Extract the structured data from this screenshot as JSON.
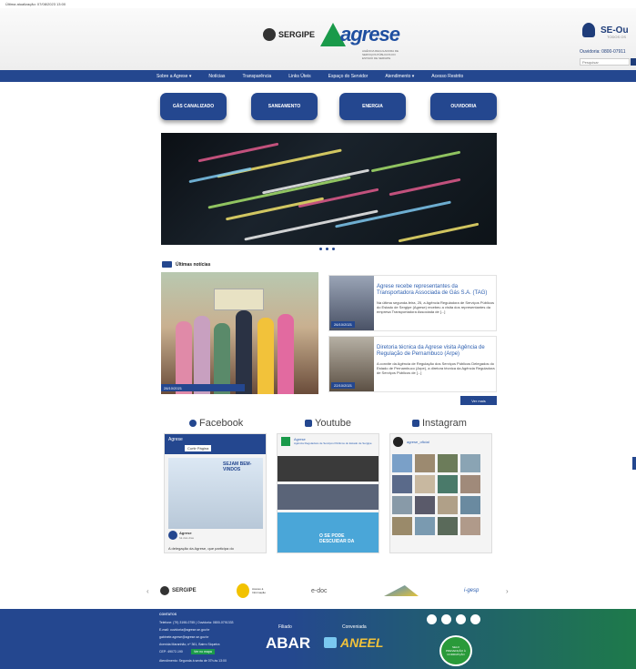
{
  "topline": "Última atualização: 07/08/2023 13:00",
  "header": {
    "sergipe_logo": "SERGIPE",
    "agrese_logo": "agrese",
    "agrese_subtitle": "AGÊNCIA REGULADORA DE SERVIÇOS PÚBLICOS DO ESTADO DE SERGIPE",
    "seou_title": "SE-Ou",
    "seou_subtitle": "TODOS OS",
    "ouvidoria": "Ouvidoria: 0800-07911",
    "search_placeholder": "Pesquisar"
  },
  "nav": {
    "items": [
      "Sobre a Agrese  ▾",
      "Notícias",
      "Transparência",
      "Links Úteis",
      "Espaço do Servidor",
      "Atendimento  ▾",
      "Acesso Restrito"
    ]
  },
  "quick_links": [
    "GÁS CANALIZADO",
    "SANEAMENTO",
    "ENERGIA",
    "OUVIDORIA"
  ],
  "news": {
    "heading": "Últimas notícias",
    "main_date": "28/10/2021",
    "items": [
      {
        "date": "26/10/2021",
        "title": "Agrese recebe representantes da Transportadora Associada de Gás S.A. (TAG)",
        "text": "Na última segunda-feira, 25, a Agência Reguladora de Serviços Públicos do Estado de Sergipe (Agrese) recebeu a visita dos representantes da empresa Transportadora Associada de [...]"
      },
      {
        "date": "22/10/2021",
        "title": "Diretoria técnica da Agrese visita Agência de Regulação de Pernambuco (Arpe)",
        "text": "A convite da Agência de Regulação dos Serviços Públicos Delegados do Estado de Pernambuco (Arpe), a diretora técnica da Agência Reguladora de Serviços Públicos de [...]"
      }
    ],
    "more": "Ver mais"
  },
  "social": {
    "facebook": "Facebook",
    "youtube": "Youtube",
    "instagram": "Instagram",
    "fb_page": "Agrese",
    "fb_follow": "Curtir Página",
    "fb_banner": "SEJAM BEM-VINDOS",
    "fb_post_author": "Agrese",
    "fb_post_time": "há dois dias",
    "fb_post_text": "A delegação da Agrese, que participa do",
    "yt_channel": "Agrese",
    "yt_desc": "Agência Reguladora de Serviços Públicos do Estado de Sergipe",
    "yt_banner": "O SE PODE DESCUIDAR DA",
    "ig_handle": "agrese_oficial"
  },
  "partners": [
    "SERGIPE",
    "Acesso à Informação",
    "e-doc",
    "SEIGA",
    "i-gesp"
  ],
  "footer": {
    "lines": [
      "CONTATOS",
      "Telefone: (79) 3198-0755 | Ouvidoria: 0800-0791333",
      "E-mail: ouvidoria@agrese.se.gov.br",
      "gabinete.agrese@agrese.se.gov.br",
      "Avenida Maranhão, nº 361, Bairro Siqueira",
      "CEP: 49072-190",
      "Atendimento: Segunda à sexta de 07h às 13:00"
    ],
    "map_button": "Ver no mapa",
    "filiado": "Filiado",
    "conveniada": "Conveniada",
    "abar": "ABAR",
    "aneel": "ANEEL",
    "badge": "SELO PREVENÇÃO À CORRUPÇÃO"
  },
  "colors": {
    "primary": "#24478f",
    "green": "#1a9a4a",
    "link": "#2d5fb0"
  }
}
